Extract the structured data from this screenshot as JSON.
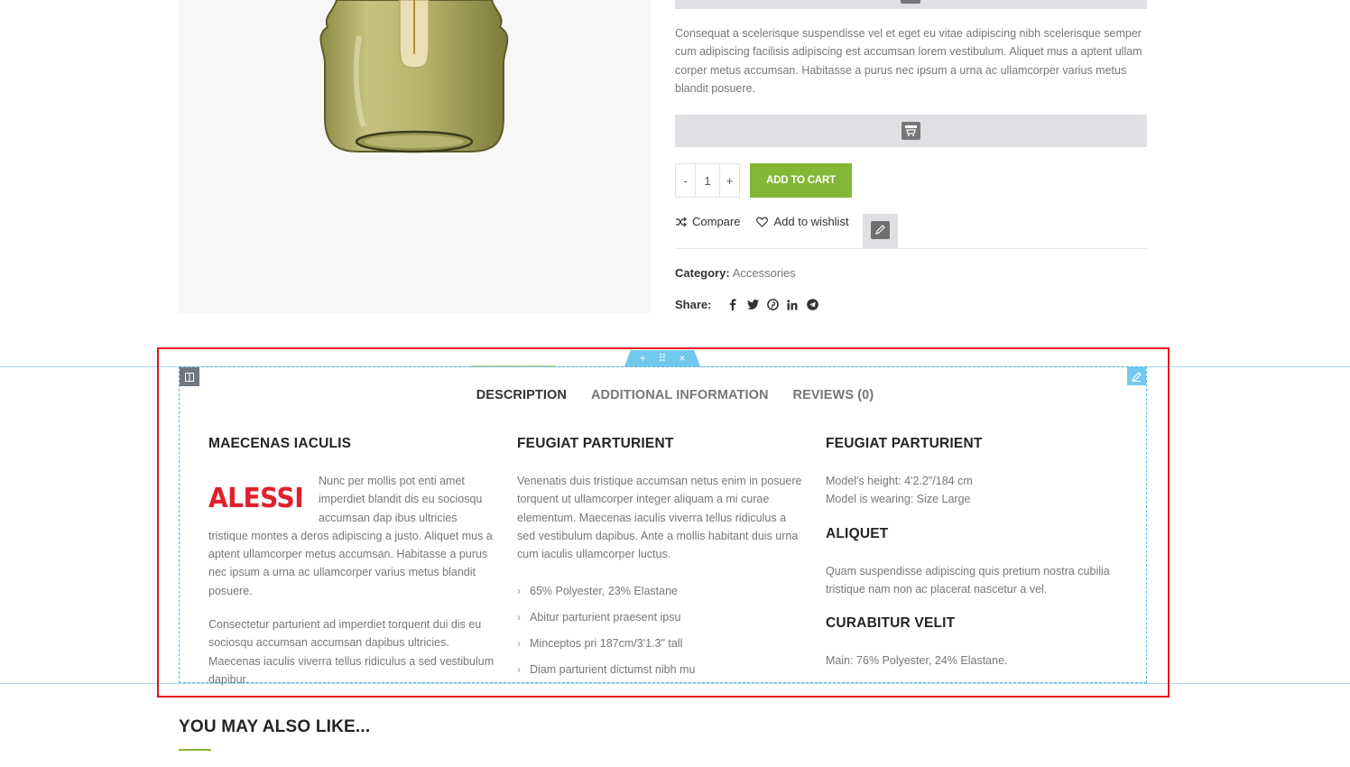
{
  "product": {
    "description": "Consequat a scelerisque suspendisse vel et eget eu vitae adipiscing nibh scelerisque semper cum adipiscing facilisis adipiscing est accumsan lorem vestibulum. Aliquet mus a aptent ullam corper metus accumsan. Habitasse a purus nec ipsum a urna ac ullamcorper varius metus blandit posuere.",
    "quantity": "1",
    "qty_minus": "-",
    "qty_plus": "+",
    "add_to_cart": "ADD TO CART",
    "compare": "Compare",
    "wishlist": "Add to wishlist",
    "category_label": "Category:",
    "category_value": "Accessories",
    "share_label": "Share:",
    "share_icons": [
      "facebook-icon",
      "twitter-icon",
      "pinterest-icon",
      "linkedin-icon",
      "telegram-icon"
    ]
  },
  "tabs": [
    {
      "label": "DESCRIPTION",
      "active": true
    },
    {
      "label": "ADDITIONAL INFORMATION",
      "active": false
    },
    {
      "label": "REVIEWS (0)",
      "active": false
    }
  ],
  "columns": {
    "col1": {
      "heading": "MAECENAS IACULIS",
      "logo_text": "ALESSI",
      "para1": "Nunc per mollis pot enti amet imperdiet blandit dis eu sociosqu accumsan dap ibus ultricies tristique montes a deros adipiscing a justo. Aliquet mus a aptent ullamcorper metus accumsan. Habitasse a purus nec ipsum a urna ac ullamcorper varius metus blandit posuere.",
      "para2": "Consectetur parturient ad imperdiet torquent dui dis eu sociosqu accumsan accumsan dapibus ultricies. Maecenas iaculis viverra tellus ridiculus a sed vestibulum dapibur."
    },
    "col2": {
      "heading": "FEUGIAT PARTURIENT",
      "para": "Venenatis duis tristique accumsan netus enim in posuere torquent ut ullamcorper integer aliquam a mi curae elementum. Maecenas iaculis viverra tellus ridiculus a sed vestibulum dapibus. Ante a mollis habitant duis urna cum iaculis ullamcorper luctus.",
      "bullets": [
        "65% Polyester, 23% Elastane",
        "Abitur parturient praesent ipsu",
        "Minceptos pri 187cm/3'1.3\" tall",
        "Diam parturient dictumst nibh mu"
      ]
    },
    "col3": {
      "heading1": "FEUGIAT PARTURIENT",
      "line1": "Model's height: 4'2.2\"/184 cm",
      "line2": "Model is wearing: Size Large",
      "heading2": "ALIQUET",
      "para2": "Quam suspendisse adipiscing quis pretium nostra cubilia tristique nam non ac placerat nascetur a vel.",
      "heading3": "CURABITUR VELIT",
      "para3": "Main: 76% Polyester, 24% Elastane."
    }
  },
  "related": {
    "title": "YOU MAY ALSO LIKE..."
  },
  "editor": {
    "handle_add": "+",
    "handle_move": "⠿",
    "handle_close": "×"
  },
  "colors": {
    "accent": "#83b735",
    "highlight_frame": "#e4141b",
    "editor_blue": "#71c9ee",
    "logo_red": "#e0212c"
  }
}
